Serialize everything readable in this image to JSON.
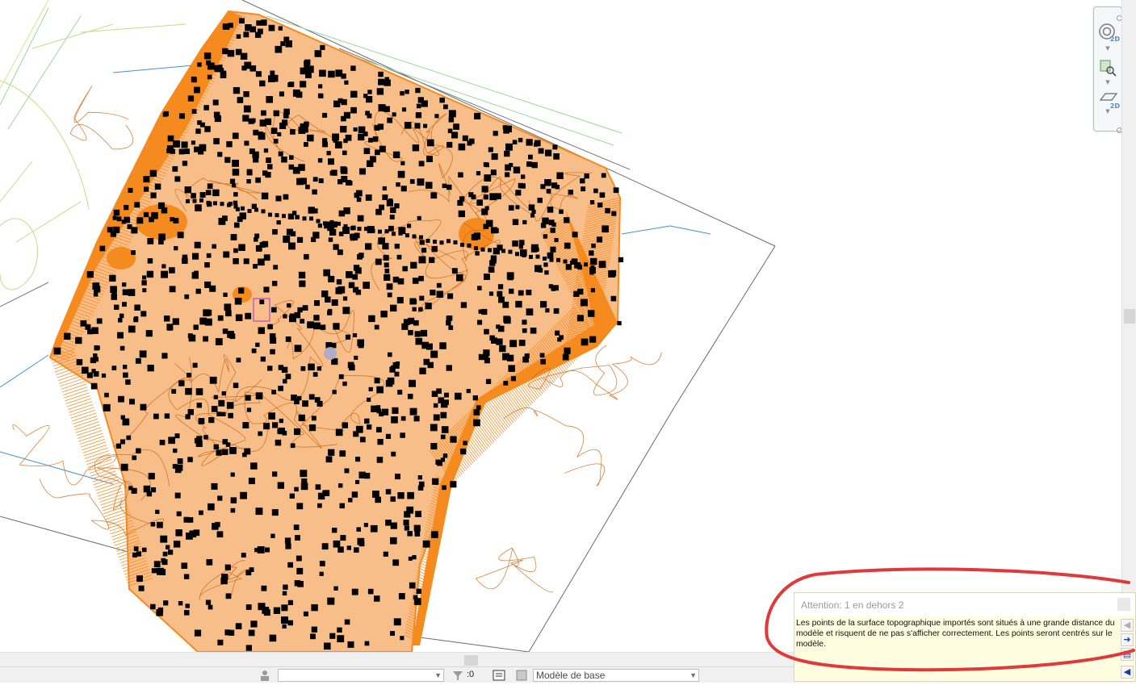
{
  "canvas": {
    "view_style": "plan-view",
    "surface_color": "#f8be8a",
    "slope_color": "#f58a1f",
    "point_color": "#000000",
    "contour_color": "#c8650f"
  },
  "navigation_bar": {
    "tools": [
      {
        "icon": "full-navigation-wheel-icon",
        "badge": "2D"
      },
      {
        "icon": "zoom-region-icon",
        "badge": ""
      },
      {
        "icon": "pan-2d-icon",
        "badge": "2D"
      }
    ]
  },
  "warning": {
    "title": "Attention: 1 en dehors 2",
    "message": "Les points de la surface topographique importés sont situés à une grande distance du modèle et risquent de ne pas s'afficher correctement. Les points seront centrés sur le modèle.",
    "highlight_color": "#e0393a"
  },
  "statusbar": {
    "workset_value": "",
    "filter_count": ":0",
    "design_option": "Modèle de base"
  }
}
